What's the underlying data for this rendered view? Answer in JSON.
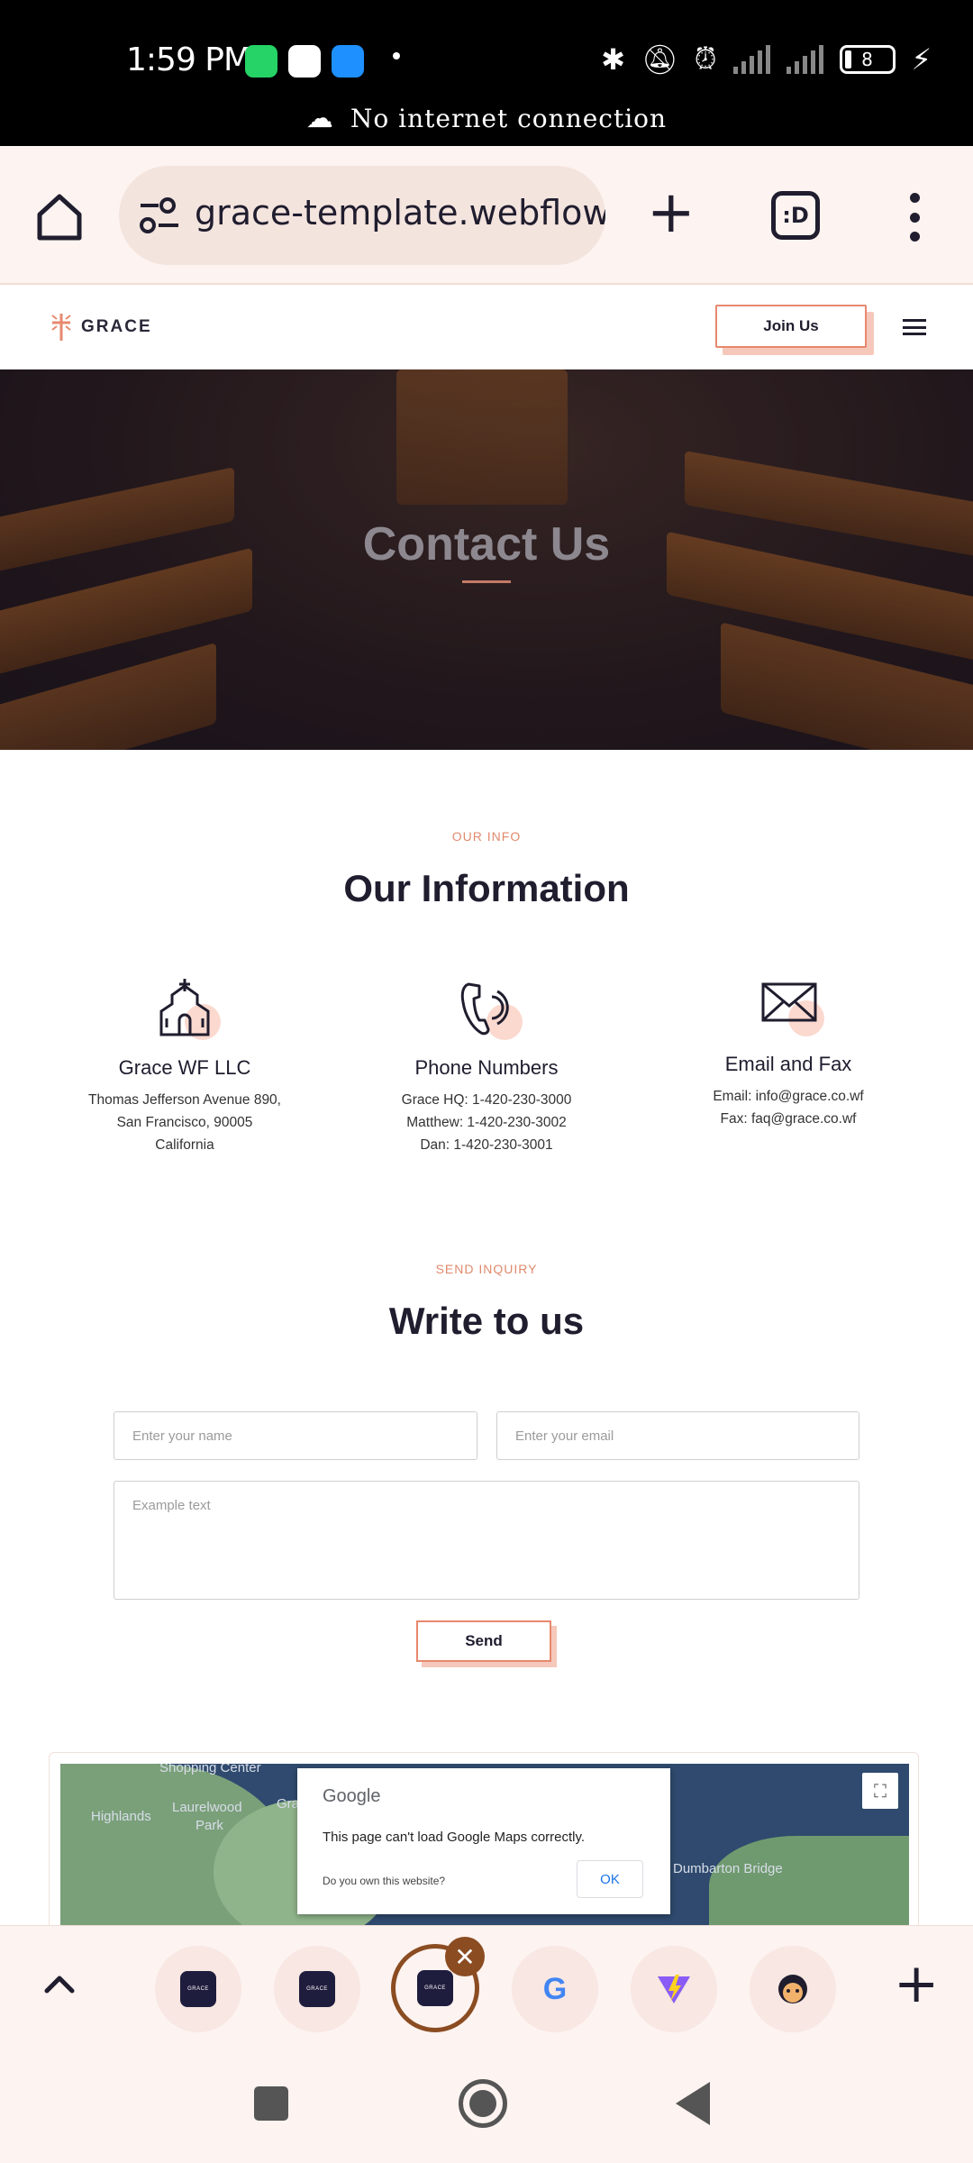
{
  "status_bar": {
    "time": "1:59 PM",
    "notice": "No internet connection",
    "battery": "8",
    "colors": {
      "whatsapp": "#25d366",
      "playstore": "#ffffff",
      "upload": "#1e90ff"
    }
  },
  "browser": {
    "url": "grace-template.webflow.io",
    "tab_switcher": ":D"
  },
  "site": {
    "logo": "GRACE",
    "join_label": "Join Us",
    "accent": "#e7886e"
  },
  "hero": {
    "title": "Contact Us"
  },
  "info_section": {
    "eyebrow": "OUR INFO",
    "title": "Our Information",
    "columns": [
      {
        "icon": "church-icon",
        "name": "Grace WF LLC",
        "lines": [
          "Thomas Jefferson Avenue 890,",
          "San Francisco, 90005",
          "California"
        ]
      },
      {
        "icon": "phone-icon",
        "name": "Phone Numbers",
        "lines": [
          "Grace HQ: 1-420-230-3000",
          "Matthew:  1-420-230-3002",
          "Dan: 1-420-230-3001"
        ]
      },
      {
        "icon": "envelope-icon",
        "name": "Email and Fax",
        "lines": [
          "Email: info@grace.co.wf",
          "Fax: faq@grace.co.wf"
        ]
      }
    ]
  },
  "inquiry_section": {
    "eyebrow": "SEND INQUIRY",
    "title": "Write to us",
    "name_placeholder": "Enter your name",
    "email_placeholder": "Enter your email",
    "message_placeholder": "Example text",
    "send_label": "Send"
  },
  "map": {
    "labels": [
      "Shopping Center",
      "Laurelwood",
      "Park",
      "Highlands",
      "Dumbarton Bridge",
      "Gra"
    ],
    "dialog": {
      "brand": "Google",
      "message": "This page can't load Google Maps correctly.",
      "question": "Do you own this website?",
      "ok_label": "OK"
    }
  },
  "tab_strip": {
    "tabs": [
      {
        "kind": "grace",
        "label": "GRACE"
      },
      {
        "kind": "grace",
        "label": "GRACE"
      },
      {
        "kind": "grace",
        "label": "GRACE",
        "active": true
      },
      {
        "kind": "google",
        "label": "G"
      },
      {
        "kind": "vite",
        "label": "V"
      },
      {
        "kind": "avatar",
        "label": ""
      }
    ]
  }
}
